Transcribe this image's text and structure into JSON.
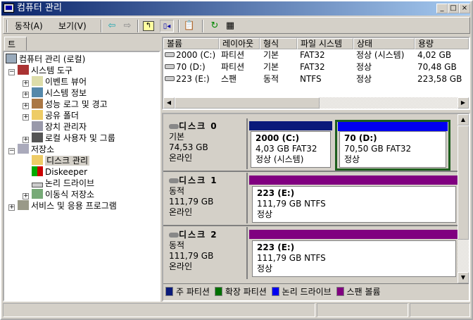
{
  "window": {
    "title": "컴퓨터 관리"
  },
  "menu": {
    "action": "동작(A)",
    "view": "보기(V)"
  },
  "toolbar": [
    "back-icon",
    "forward-icon",
    "up-icon",
    "show-hide-tree-icon",
    "properties-icon",
    "refresh-icon",
    "export-icon"
  ],
  "tree": {
    "tab": "트리",
    "items": [
      {
        "label": "컴퓨터 관리 (로컬)"
      },
      {
        "label": "시스템 도구"
      },
      {
        "label": "이벤트 뷰어"
      },
      {
        "label": "시스템 정보"
      },
      {
        "label": "성능 로그 및 경고"
      },
      {
        "label": "공유 폴더"
      },
      {
        "label": "장치 관리자"
      },
      {
        "label": "로컬 사용자 및 그룹"
      },
      {
        "label": "저장소"
      },
      {
        "label": "디스크 관리"
      },
      {
        "label": "Diskeeper"
      },
      {
        "label": "논리 드라이브"
      },
      {
        "label": "이동식 저장소"
      },
      {
        "label": "서비스 및 응용 프로그램"
      }
    ]
  },
  "volumes": {
    "columns": [
      "볼륨",
      "레이아웃",
      "형식",
      "파일 시스템",
      "상태",
      "용량"
    ],
    "rows": [
      [
        "2000 (C:)",
        "파티션",
        "기본",
        "FAT32",
        "정상 (시스템)",
        "4,02 GB"
      ],
      [
        "70 (D:)",
        "파티션",
        "기본",
        "FAT32",
        "정상",
        "70,48 GB"
      ],
      [
        "223 (E:)",
        "스팬",
        "동적",
        "NTFS",
        "정상",
        "223,58 GB"
      ]
    ]
  },
  "disks": [
    {
      "name": "디스크 0",
      "type": "기본",
      "size": "74,53 GB",
      "state": "온라인",
      "parts": [
        {
          "name": "2000  (C:)",
          "size": "4,03 GB FAT32",
          "status": "정상 (시스템)",
          "color": "#0a1a7a"
        },
        {
          "name": "70  (D:)",
          "size": "70,50 GB FAT32",
          "status": "정상",
          "color": "#0000f0"
        }
      ]
    },
    {
      "name": "디스크 1",
      "type": "동적",
      "size": "111,79 GB",
      "state": "온라인",
      "parts": [
        {
          "name": "223  (E:)",
          "size": "111,79 GB NTFS",
          "status": "정상",
          "color": "#800080"
        }
      ]
    },
    {
      "name": "디스크 2",
      "type": "동적",
      "size": "111,79 GB",
      "state": "온라인",
      "parts": [
        {
          "name": "223  (E:)",
          "size": "111,79 GB NTFS",
          "status": "정상",
          "color": "#800080"
        }
      ]
    }
  ],
  "legend": [
    {
      "label": "주 파티션",
      "color": "#0a1a7a"
    },
    {
      "label": "확장 파티션",
      "color": "#007000"
    },
    {
      "label": "논리 드라이브",
      "color": "#0000f0"
    },
    {
      "label": "스팬 볼륨",
      "color": "#800080"
    }
  ]
}
